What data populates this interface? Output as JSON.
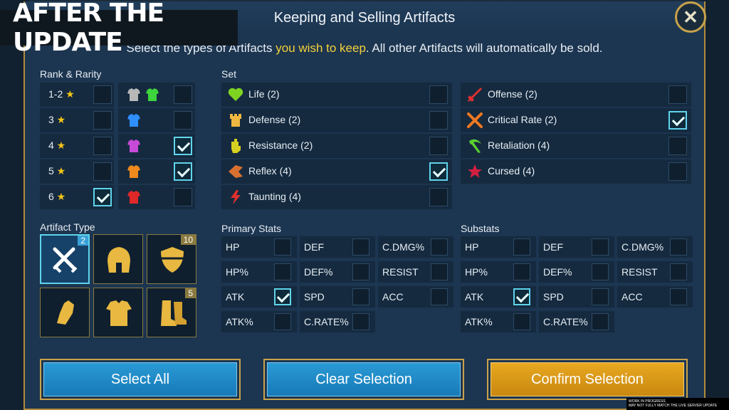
{
  "banner": "AFTER THE UPDATE",
  "dialog": {
    "title": "Keeping and Selling Artifacts",
    "subtitle_pre": "Select the types of Artifacts ",
    "subtitle_hl": "you wish to keep",
    "subtitle_post": ". All other Artifacts will automatically be sold."
  },
  "rank_rarity": {
    "label": "Rank & Rarity",
    "ranks": [
      {
        "label": "1-2",
        "checked": false
      },
      {
        "label": "3",
        "checked": false
      },
      {
        "label": "4",
        "checked": false
      },
      {
        "label": "5",
        "checked": false
      },
      {
        "label": "6",
        "checked": true
      }
    ],
    "rarities": [
      {
        "colors": [
          "#b8b8b8",
          "#3dd33d"
        ],
        "checked": false
      },
      {
        "colors": [
          "#2f8fff"
        ],
        "checked": false
      },
      {
        "colors": [
          "#c84ad8"
        ],
        "checked": true
      },
      {
        "colors": [
          "#f08a1c"
        ],
        "checked": true
      },
      {
        "colors": [
          "#e02828"
        ],
        "checked": false
      }
    ]
  },
  "sets": {
    "label": "Set",
    "col1": [
      {
        "label": "Life (2)",
        "icon": "heart-icon",
        "color": "#7ed321",
        "checked": false
      },
      {
        "label": "Defense (2)",
        "icon": "tower-icon",
        "color": "#f0b840",
        "checked": false
      },
      {
        "label": "Resistance (2)",
        "icon": "fist-icon",
        "color": "#d8d020",
        "checked": false
      },
      {
        "label": "Reflex (4)",
        "icon": "reflex-icon",
        "color": "#d87030",
        "checked": true
      },
      {
        "label": "Taunting (4)",
        "icon": "lightning-icon",
        "color": "#e03030",
        "checked": false
      }
    ],
    "col2": [
      {
        "label": "Offense (2)",
        "icon": "sword-icon",
        "color": "#e03030",
        "checked": false
      },
      {
        "label": "Critical Rate (2)",
        "icon": "crossed-swords-icon",
        "color": "#f07820",
        "checked": true
      },
      {
        "label": "Retaliation (4)",
        "icon": "pickaxe-icon",
        "color": "#5ad030",
        "checked": false
      },
      {
        "label": "Cursed (4)",
        "icon": "pentagram-icon",
        "color": "#d02040",
        "checked": false
      }
    ]
  },
  "artifact_type": {
    "label": "Artifact Type",
    "items": [
      {
        "icon": "weapon-icon",
        "count": "2",
        "selected": true
      },
      {
        "icon": "helmet-icon",
        "count": "",
        "selected": false
      },
      {
        "icon": "shield-icon",
        "count": "10",
        "selected": false
      },
      {
        "icon": "gauntlets-icon",
        "count": "",
        "selected": false
      },
      {
        "icon": "chestplate-icon",
        "count": "",
        "selected": false
      },
      {
        "icon": "boots-icon",
        "count": "5",
        "selected": false
      }
    ]
  },
  "primary_stats": {
    "label": "Primary Stats",
    "items": [
      {
        "label": "HP",
        "checked": false
      },
      {
        "label": "DEF",
        "checked": false
      },
      {
        "label": "C.DMG%",
        "checked": false
      },
      {
        "label": "HP%",
        "checked": false
      },
      {
        "label": "DEF%",
        "checked": false
      },
      {
        "label": "RESIST",
        "checked": false
      },
      {
        "label": "ATK",
        "checked": true
      },
      {
        "label": "SPD",
        "checked": false
      },
      {
        "label": "ACC",
        "checked": false
      },
      {
        "label": "ATK%",
        "checked": false
      },
      {
        "label": "C.RATE%",
        "checked": false
      }
    ]
  },
  "substats": {
    "label": "Substats",
    "items": [
      {
        "label": "HP",
        "checked": false
      },
      {
        "label": "DEF",
        "checked": false
      },
      {
        "label": "C.DMG%",
        "checked": false
      },
      {
        "label": "HP%",
        "checked": false
      },
      {
        "label": "DEF%",
        "checked": false
      },
      {
        "label": "RESIST",
        "checked": false
      },
      {
        "label": "ATK",
        "checked": true
      },
      {
        "label": "SPD",
        "checked": false
      },
      {
        "label": "ACC",
        "checked": false
      },
      {
        "label": "ATK%",
        "checked": false
      },
      {
        "label": "C.RATE%",
        "checked": false
      }
    ]
  },
  "buttons": {
    "select_all": "Select All",
    "clear": "Clear Selection",
    "confirm": "Confirm Selection"
  },
  "watermark": [
    "WORK IN PROGRESS",
    "MAY NOT FULLY MATCH THE LIVE SERVER UPDATE"
  ]
}
